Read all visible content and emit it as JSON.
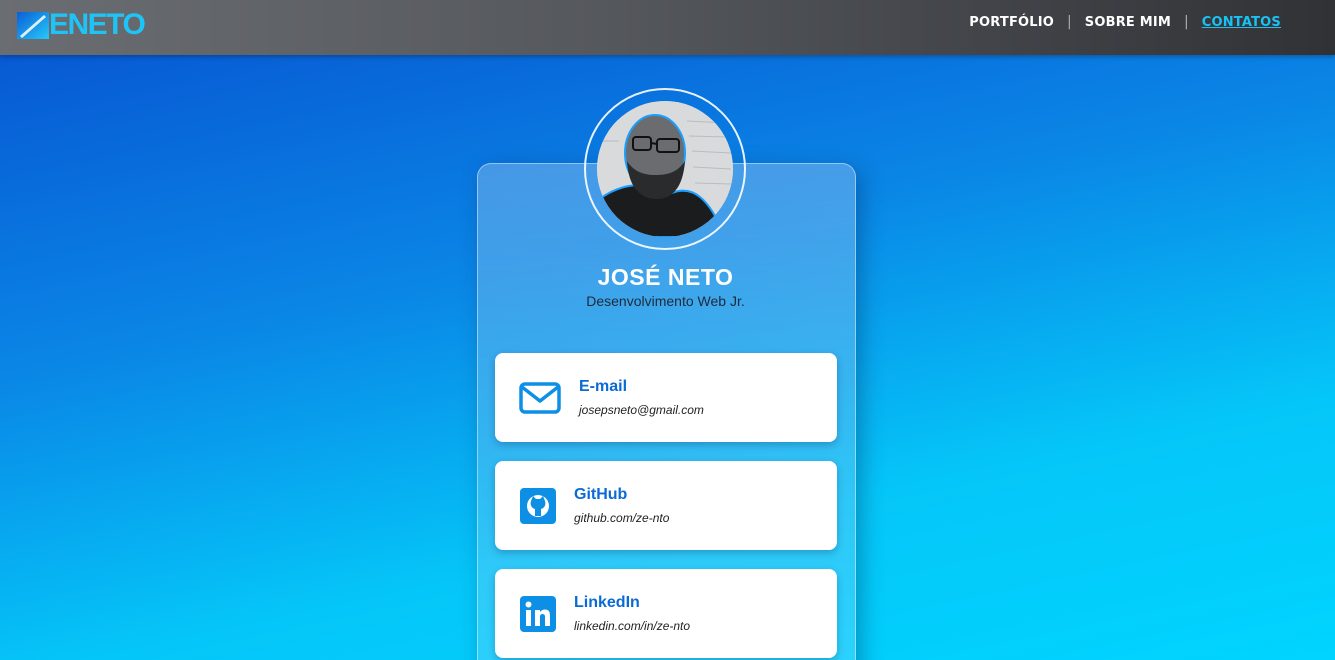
{
  "header": {
    "logo_text": "ENETO",
    "nav": [
      {
        "label": "PORTFÓLIO"
      },
      {
        "label": "SOBRE MIM"
      },
      {
        "label": "CONTATOS",
        "active": true
      }
    ],
    "separator": "|"
  },
  "profile": {
    "name": "JOSÉ NETO",
    "role": "Desenvolvimento Web Jr."
  },
  "contacts": [
    {
      "icon": "envelope-icon",
      "title": "E-mail",
      "value": "josepsneto@gmail.com"
    },
    {
      "icon": "github-icon",
      "title": "GitHub",
      "value": "github.com/ze-nto"
    },
    {
      "icon": "linkedin-icon",
      "title": "LinkedIn",
      "value": "linkedin.com/in/ze-nto"
    }
  ],
  "colors": {
    "accent": "#1ac2f4",
    "link_title": "#0a6ad6",
    "icon": "#0d8fe6"
  }
}
